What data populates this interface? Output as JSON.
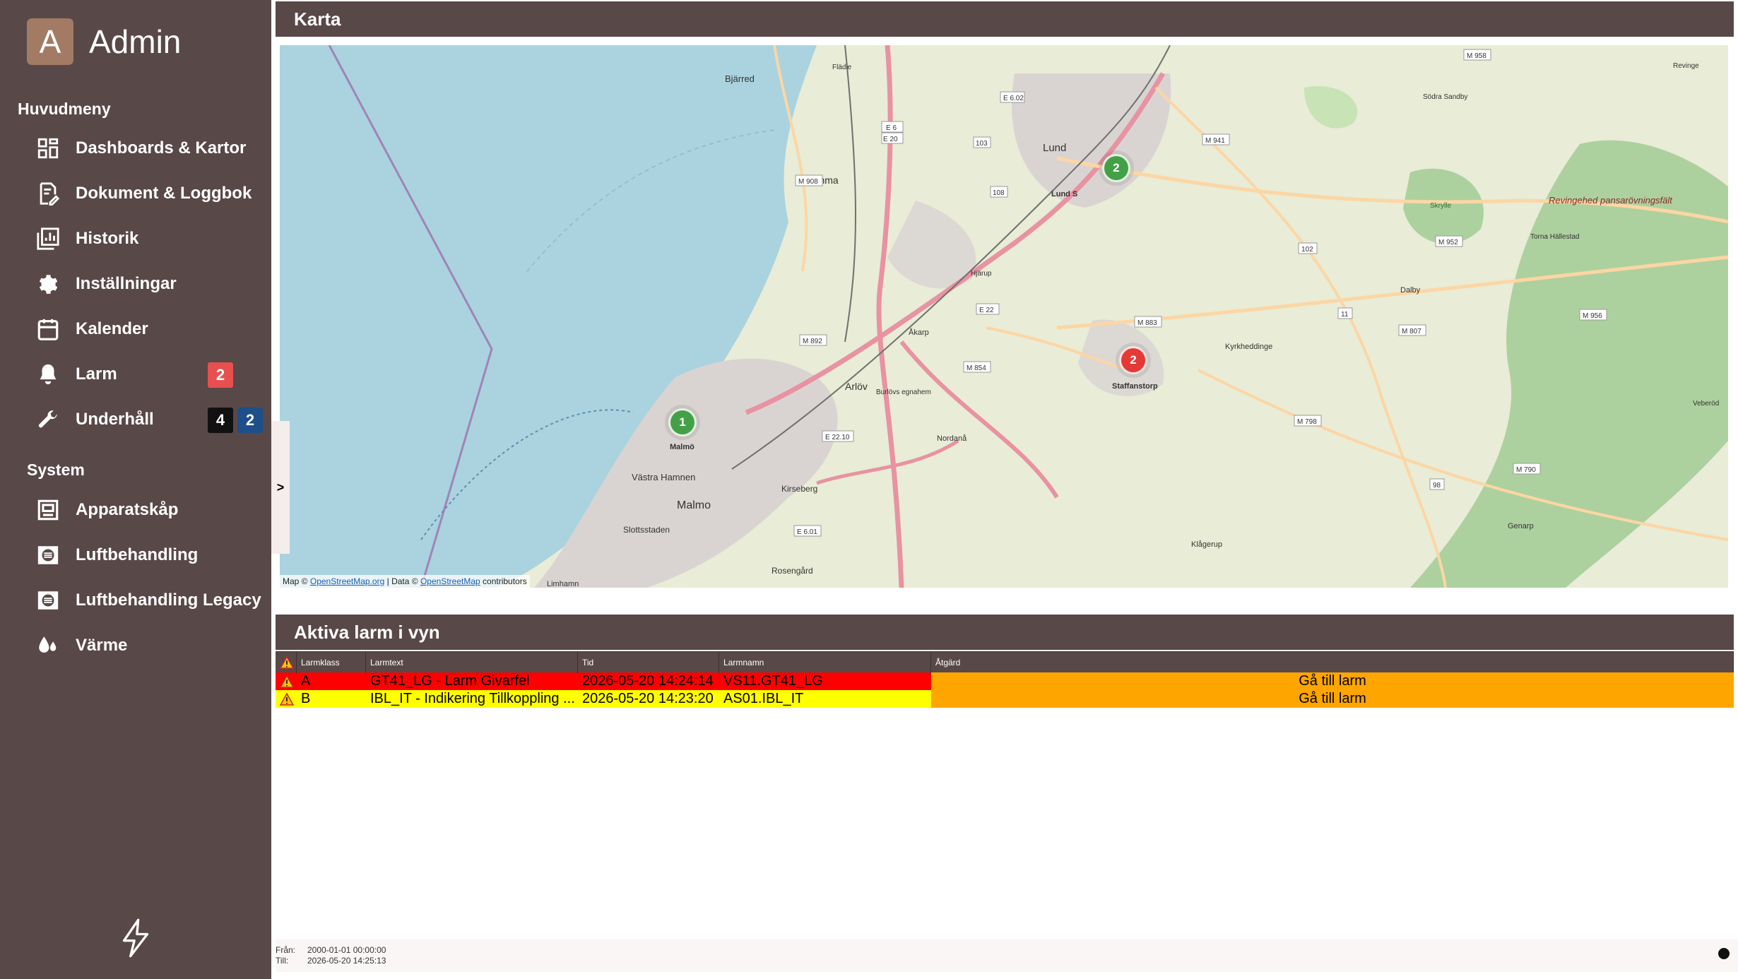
{
  "sidebar": {
    "brand_letter": "A",
    "brand_name": "Admin",
    "main_menu_title": "Huvudmeny",
    "system_title": "System",
    "items": [
      {
        "label": "Dashboards & Kartor",
        "icon": "dashboard-icon"
      },
      {
        "label": "Dokument & Loggbok",
        "icon": "document-icon"
      },
      {
        "label": "Historik",
        "icon": "history-chart-icon"
      },
      {
        "label": "Inställningar",
        "icon": "gear-icon"
      },
      {
        "label": "Kalender",
        "icon": "calendar-icon"
      },
      {
        "label": "Larm",
        "icon": "bell-icon",
        "badge": "2",
        "badge_color": "#e7504f"
      },
      {
        "label": "Underhåll",
        "icon": "wrench-icon",
        "badges": [
          "4",
          "2"
        ],
        "badge_colors": [
          "#111111",
          "#1d4f8a"
        ]
      }
    ],
    "system_items": [
      {
        "label": "Apparatskåp",
        "icon": "cabinet-icon"
      },
      {
        "label": "Luftbehandling",
        "icon": "air-handling-icon"
      },
      {
        "label": "Luftbehandling Legacy",
        "icon": "air-handling-icon"
      },
      {
        "label": "Värme",
        "icon": "heat-drop-icon"
      }
    ]
  },
  "map_panel": {
    "title": "Karta",
    "collapse_label": ">",
    "place_labels": {
      "bjarred": "Bjärred",
      "lomma": "Lomma",
      "lund": "Lund",
      "lund_s": "Lund S",
      "malmo_label": "Malmö",
      "malmo": "Malmo",
      "arlov": "Arlöv",
      "akarp": "Åkarp",
      "staffanstorp": "Staffanstorp",
      "vastra_hamnen": "Västra Hamnen",
      "kirseberg": "Kirseberg",
      "slottsstaden": "Slottsstaden",
      "rosengard": "Rosengård",
      "limhamn": "Limhamn",
      "dalby": "Dalby",
      "revinge": "Revingehed pansarövningsfält",
      "kyrkheddinge": "Kyrkheddinge",
      "nordana": "Nordanå",
      "burlovs": "Burlövs egnahem",
      "genarp": "Genarp",
      "klagerup": "Klågerup",
      "hjarup": "Hjärup",
      "flädie": "Flädie",
      "sodra_sandby": "Södra Sandby",
      "torna": "Torna Hällestad",
      "veberod": "Veberöd",
      "revinge_small": "Revinge",
      "skrylle": "Skrylle"
    },
    "road_labels": [
      "E 6.02",
      "E 6",
      "E 20",
      "M 908",
      "103",
      "108",
      "M 941",
      "E 22",
      "M 883",
      "M 892",
      "M 854",
      "E 22.10",
      "E 6.01",
      "M 798",
      "102",
      "M 952",
      "M 956",
      "M 807",
      "M 958",
      "11",
      "M 790",
      "98"
    ],
    "markers": [
      {
        "count": "2",
        "color": "#43a047"
      },
      {
        "count": "2",
        "color": "#e53935"
      },
      {
        "count": "1",
        "color": "#43a047"
      }
    ],
    "attribution": {
      "prefix": "Map ©",
      "osm_link": "OpenStreetMap.org",
      "data": "| Data ©",
      "osm_link2": "OpenStreetMap",
      "suffix": "contributors"
    }
  },
  "alarm_panel": {
    "title": "Aktiva larm i vyn",
    "columns": [
      "Larmklass",
      "Larmtext",
      "Tid",
      "Larmnamn",
      "Åtgärd"
    ],
    "rows": [
      {
        "klass": "A",
        "text": "GT41_LG - Larm Givarfel",
        "tid": "2026-05-20 14:24:14",
        "namn": "VS11.GT41_LG",
        "action": "Gå till larm",
        "row_color": "#ff0000"
      },
      {
        "klass": "B",
        "text": "IBL_IT - Indikering Tillkoppling ...",
        "tid": "2026-05-20 14:23:20",
        "namn": "AS01.IBL_IT",
        "action": "Gå till larm",
        "row_color": "#ffff00"
      }
    ],
    "action_color": "#ffa500"
  },
  "footer": {
    "from_label": "Från:",
    "from_value": "2000-01-01 00:00:00",
    "to_label": "Till:",
    "to_value": "2026-05-20 14:25:13"
  }
}
